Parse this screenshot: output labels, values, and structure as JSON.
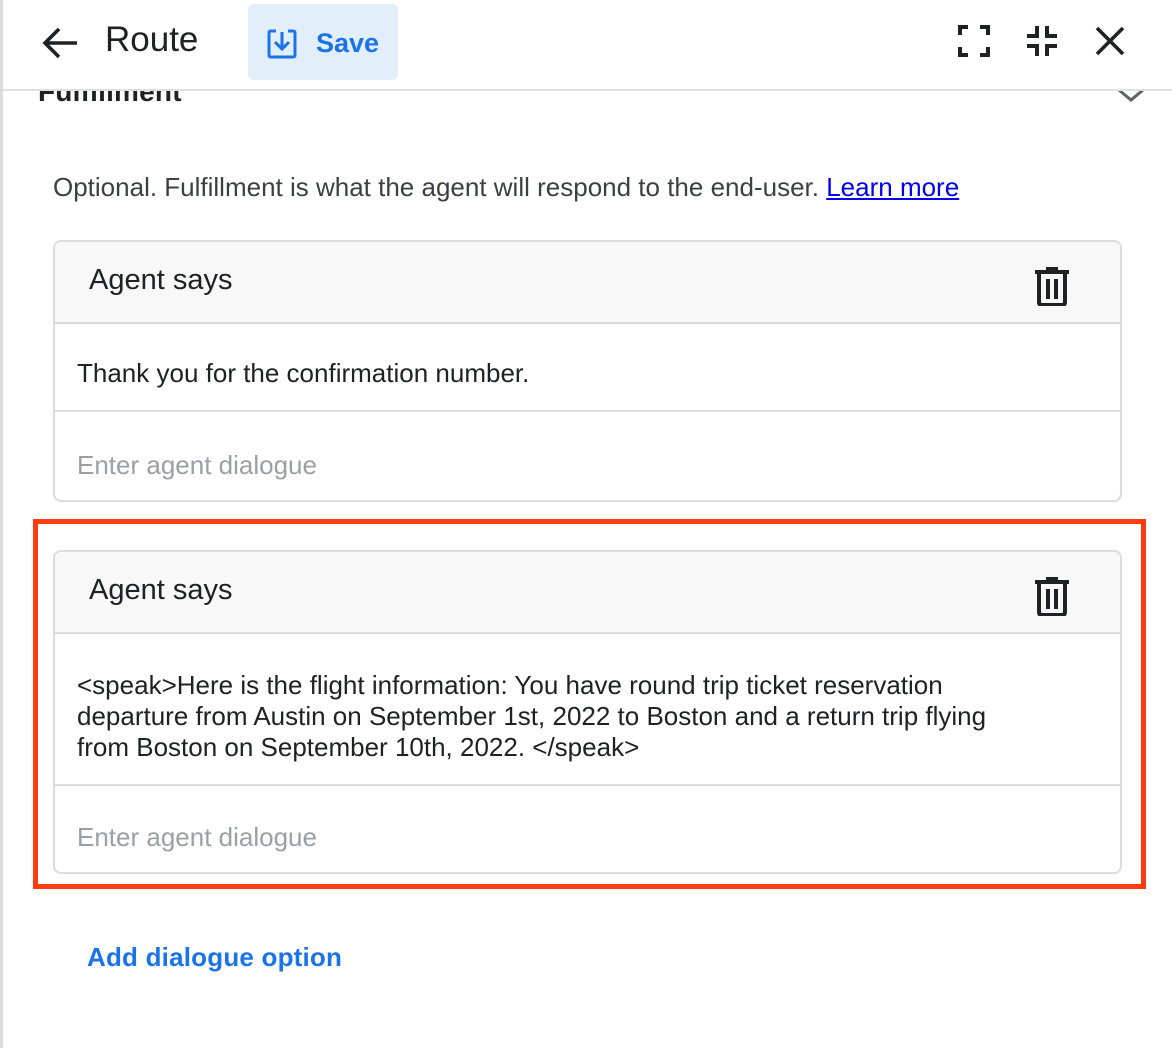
{
  "header": {
    "title": "Route",
    "save_label": "Save",
    "icons": {
      "back": "arrow-back-icon",
      "save": "save-download-icon",
      "fullscreen": "fullscreen-icon",
      "exit_fullscreen": "fullscreen-exit-icon",
      "close": "close-icon"
    }
  },
  "section": {
    "title": "Fulfillment",
    "description": "Optional. Fulfillment is what the agent will respond to the end-user.",
    "learn_more": "Learn more"
  },
  "dialogue_cards": [
    {
      "title": "Agent says",
      "text": "Thank you for the confirmation number.",
      "input_placeholder": "Enter agent dialogue",
      "input_value": ""
    },
    {
      "title": "Agent says",
      "text": "<speak>Here is the flight information: You have round trip ticket reservation departure from Austin on September 1st, 2022 to Boston and a return trip flying from Boston on September 10th, 2022. </speak>",
      "input_placeholder": "Enter agent dialogue",
      "input_value": "",
      "highlighted": true
    }
  ],
  "add_option_label": "Add dialogue option",
  "colors": {
    "accent": "#1a73e8",
    "save_bg": "#e3eefb",
    "highlight": "#fc3d11",
    "link": "#0000ee"
  }
}
